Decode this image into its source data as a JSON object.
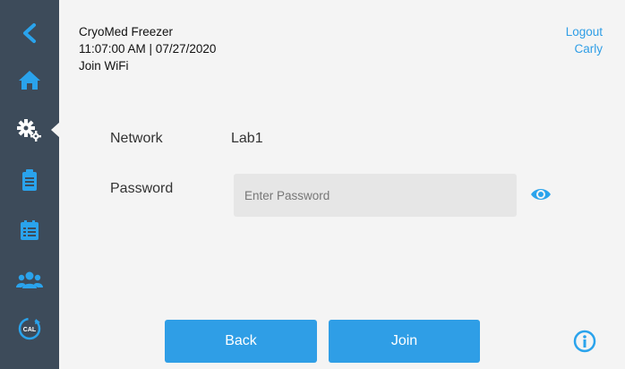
{
  "sidebar": {
    "items": [
      {
        "icon": "back-arrow-icon"
      },
      {
        "icon": "home-icon"
      },
      {
        "icon": "gears-icon",
        "active": true
      },
      {
        "icon": "clipboard-icon"
      },
      {
        "icon": "calendar-list-icon"
      },
      {
        "icon": "users-icon"
      },
      {
        "icon": "calibration-icon",
        "icon_text": "CAL"
      }
    ]
  },
  "header": {
    "device_name": "CryoMed Freezer",
    "datetime": "11:07:00 AM | 07/27/2020",
    "page_title": "Join WiFi"
  },
  "user": {
    "logout_label": "Logout",
    "username": "Carly"
  },
  "form": {
    "network_label": "Network",
    "network_value": "Lab1",
    "password_label": "Password",
    "password_placeholder": "Enter Password",
    "password_value": ""
  },
  "actions": {
    "back_label": "Back",
    "join_label": "Join"
  },
  "colors": {
    "sidebar_bg": "#3d4b5a",
    "accent": "#2f9ee6",
    "icon": "#29a3ec"
  }
}
